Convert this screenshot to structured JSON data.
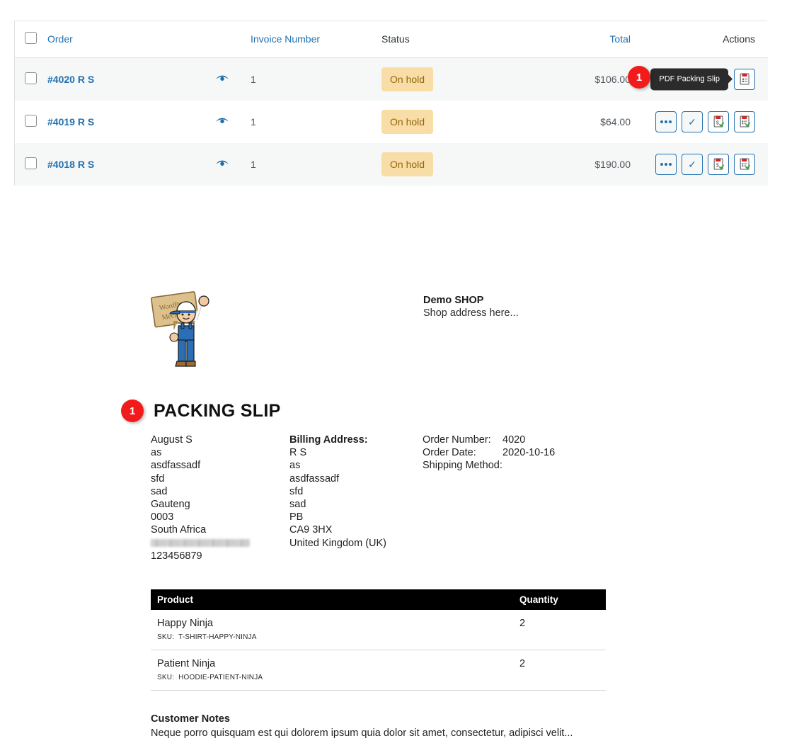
{
  "orders_table": {
    "columns": [
      {
        "key": "cb",
        "label": "",
        "sortable": false
      },
      {
        "key": "order",
        "label": "Order",
        "sortable": true
      },
      {
        "key": "inv",
        "label": "Invoice Number",
        "sortable": true
      },
      {
        "key": "status",
        "label": "Status",
        "sortable": false
      },
      {
        "key": "total",
        "label": "Total",
        "sortable": true
      },
      {
        "key": "act",
        "label": "Actions",
        "sortable": false
      }
    ],
    "rows": [
      {
        "order": "#4020 R S",
        "invoice": "1",
        "status": "On hold",
        "total": "$106.00"
      },
      {
        "order": "#4019 R S",
        "invoice": "1",
        "status": "On hold",
        "total": "$64.00"
      },
      {
        "order": "#4018 R S",
        "invoice": "1",
        "status": "On hold",
        "total": "$190.00"
      }
    ],
    "tooltip": "PDF Packing Slip",
    "marker_1": "1",
    "status_bg": "#f8dda7",
    "status_fg": "#94660c",
    "link_color": "#2271b1",
    "marker_color": "#f11b1b"
  },
  "packing_slip": {
    "marker": "1",
    "title": "PACKING SLIP",
    "shop": {
      "name": "Demo SHOP",
      "address": "Shop address here..."
    },
    "logo_alt": "WordPress Mechanic",
    "logo_sign_line1": "WordPress",
    "logo_sign_line2": "Mechanic",
    "shipping_address": {
      "lines": [
        "August S",
        "as",
        "asdfassadf",
        "sfd",
        "sad",
        "Gauteng",
        "0003",
        "South Africa"
      ],
      "email_redacted": true,
      "phone": "123456879"
    },
    "billing_address": {
      "heading": "Billing Address:",
      "lines": [
        "R S",
        "as",
        "asdfassadf",
        "sfd",
        "sad",
        "PB",
        "CA9 3HX",
        "United Kingdom (UK)"
      ]
    },
    "meta": [
      {
        "label": "Order Number:",
        "value": "4020"
      },
      {
        "label": "Order Date:",
        "value": "2020-10-16"
      },
      {
        "label": "Shipping Method:",
        "value": ""
      }
    ],
    "products": {
      "headers": {
        "product": "Product",
        "quantity": "Quantity"
      },
      "sku_label": "SKU:",
      "rows": [
        {
          "name": "Happy Ninja",
          "sku": "T-SHIRT-HAPPY-NINJA",
          "qty": "2"
        },
        {
          "name": "Patient Ninja",
          "sku": "HOODIE-PATIENT-NINJA",
          "qty": "2"
        }
      ]
    },
    "customer_notes": {
      "title": "Customer Notes",
      "text": "Neque porro quisquam est qui dolorem ipsum quia dolor sit amet, consectetur, adipisci velit..."
    }
  }
}
